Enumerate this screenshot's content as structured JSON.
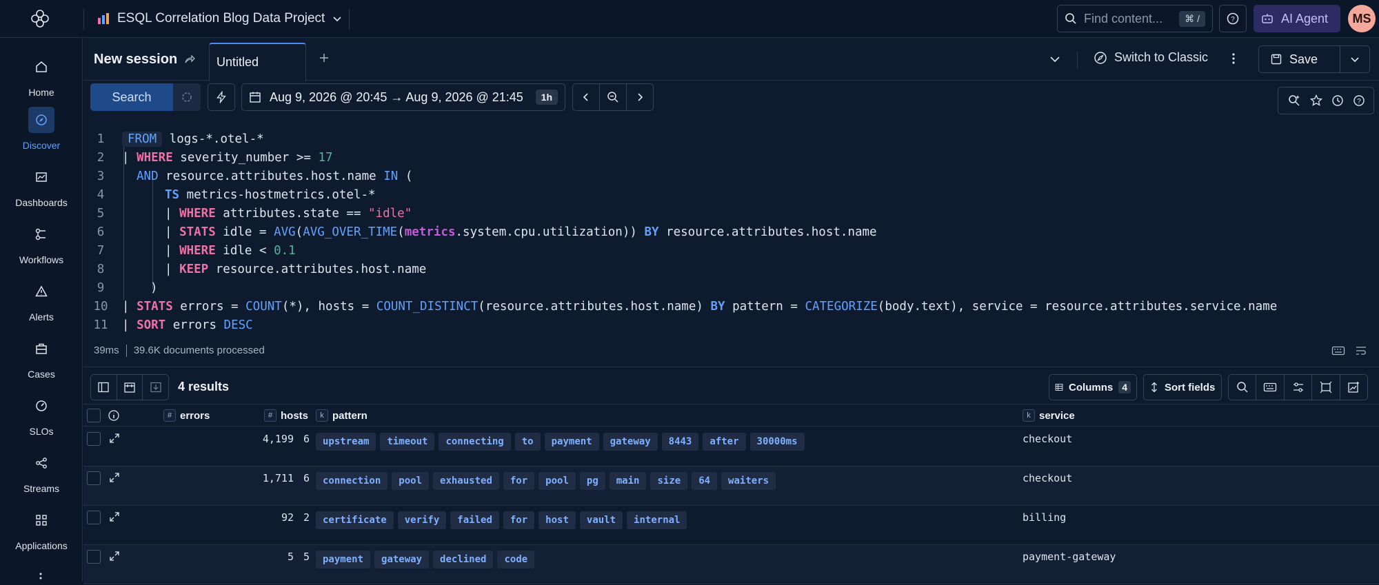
{
  "project": {
    "name": "ESQL Correlation Blog Data Project"
  },
  "search": {
    "placeholder": "Find content...",
    "shortcut": "⌘ /"
  },
  "ai_agent": {
    "label": "AI Agent"
  },
  "user": {
    "initials": "MS"
  },
  "nav": [
    {
      "label": "Home",
      "icon": "home-icon"
    },
    {
      "label": "Discover",
      "icon": "compass-icon",
      "active": true
    },
    {
      "label": "Dashboards",
      "icon": "dashboard-icon"
    },
    {
      "label": "Workflows",
      "icon": "workflow-icon"
    },
    {
      "label": "Alerts",
      "icon": "alert-icon"
    },
    {
      "label": "Cases",
      "icon": "briefcase-icon"
    },
    {
      "label": "SLOs",
      "icon": "gauge-icon"
    },
    {
      "label": "Streams",
      "icon": "streams-icon"
    },
    {
      "label": "Applications",
      "icon": "grid-icon"
    }
  ],
  "session": {
    "title": "New session",
    "tab": "Untitled"
  },
  "switch_classic": "Switch to Classic",
  "save": {
    "label": "Save"
  },
  "toolbar": {
    "search_label": "Search",
    "date_range": "Aug 9, 2026 @ 20:45 → Aug 9, 2026 @ 21:45",
    "date_badge": "1h"
  },
  "query": {
    "line_numbers": [
      "1",
      "2",
      "3",
      "4",
      "5",
      "6",
      "7",
      "8",
      "9",
      "10",
      "11"
    ],
    "l1": {
      "kw": "FROM",
      "rest": " logs-*.otel-*"
    },
    "l2": {
      "pipe": "| ",
      "kw": "WHERE",
      "rest": " severity_number >= ",
      "num": "17"
    },
    "l3": {
      "kw": "AND",
      "mid": " resource.attributes.host.name ",
      "kw2": "IN",
      "rest": " ("
    },
    "l4": {
      "kw": "TS",
      "rest": " metrics-hostmetrics.otel-*"
    },
    "l5": {
      "pipe": "| ",
      "kw": "WHERE",
      "rest": " attributes.state == ",
      "str": "\"idle\""
    },
    "l6": {
      "pipe": "| ",
      "kw": "STATS",
      "a": " idle = ",
      "f1": "AVG",
      "b": "(",
      "f2": "AVG_OVER_TIME",
      "c": "(",
      "m": "metrics",
      "d": ".system.cpu.utilization)) ",
      "kw2": "BY",
      "e": " resource.attributes.host.name"
    },
    "l7": {
      "pipe": "| ",
      "kw": "WHERE",
      "rest": " idle < ",
      "num": "0.1"
    },
    "l8": {
      "pipe": "| ",
      "kw": "KEEP",
      "rest": " resource.attributes.host.name"
    },
    "l9": {
      "rest": ")"
    },
    "l10": {
      "pipe": "| ",
      "kw": "STATS",
      "a": " errors = ",
      "f1": "COUNT",
      "b": "(*), hosts = ",
      "f2": "COUNT_DISTINCT",
      "c": "(resource.attributes.host.name) ",
      "kw2": "BY",
      "d": " pattern = ",
      "f3": "CATEGORIZE",
      "e": "(body.text), service = resource.attributes.service.name"
    },
    "l11": {
      "pipe": "| ",
      "kw": "SORT",
      "rest": " errors ",
      "kw2": "DESC"
    }
  },
  "stats": {
    "time": "39ms",
    "docs": "39.6K documents processed"
  },
  "results": {
    "count_label": "4 results",
    "columns_label": "Columns",
    "columns_count": "4",
    "sort_label": "Sort fields",
    "headers": {
      "errors": "errors",
      "hosts": "hosts",
      "pattern": "pattern",
      "service": "service"
    },
    "type_tags": {
      "number": "#",
      "keyword": "k"
    },
    "rows": [
      {
        "errors": "4,199",
        "hosts": "6",
        "pattern": [
          "upstream",
          "timeout",
          "connecting",
          "to",
          "payment",
          "gateway",
          "8443",
          "after",
          "30000ms"
        ],
        "service": "checkout"
      },
      {
        "errors": "1,711",
        "hosts": "6",
        "pattern": [
          "connection",
          "pool",
          "exhausted",
          "for",
          "pool",
          "pg",
          "main",
          "size",
          "64",
          "waiters"
        ],
        "service": "checkout"
      },
      {
        "errors": "92",
        "hosts": "2",
        "pattern": [
          "certificate",
          "verify",
          "failed",
          "for",
          "host",
          "vault",
          "internal"
        ],
        "service": "billing"
      },
      {
        "errors": "5",
        "hosts": "5",
        "pattern": [
          "payment",
          "gateway",
          "declined",
          "code"
        ],
        "service": "payment-gateway"
      }
    ]
  }
}
